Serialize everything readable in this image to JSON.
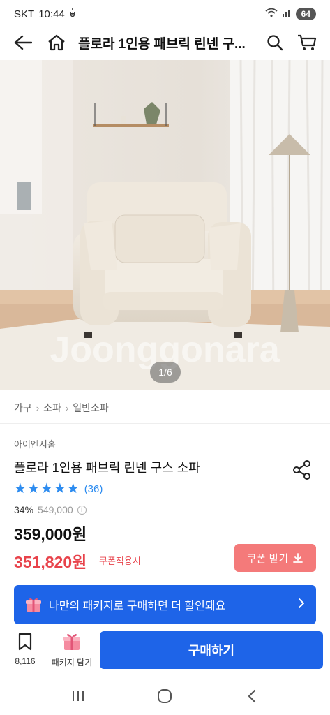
{
  "status": {
    "carrier": "SKT",
    "time": "10:44",
    "battery": "64"
  },
  "header": {
    "title": "플로라 1인용 패브릭 린넨 구..."
  },
  "hero": {
    "watermark": "Joonggonara",
    "page_indicator": "1/6"
  },
  "breadcrumb": [
    "가구",
    "소파",
    "일반소파"
  ],
  "product": {
    "brand": "아이엔지홈",
    "name": "플로라 1인용 패브릭 린넨 구스 소파",
    "rating_stars": 5,
    "review_count": "(36)",
    "discount_rate": "34%",
    "original_price": "549,000",
    "price": "359,000원",
    "coupon_price": "351,820원",
    "coupon_label": "쿠폰적용시",
    "coupon_button": "쿠폰 받기"
  },
  "package_banner": {
    "text": "나만의 패키지로 구매하면 더 할인돼요"
  },
  "bottom_bar": {
    "wish_count": "8,116",
    "package_label": "패키지 담기",
    "buy_label": "구매하기"
  },
  "colors": {
    "accent_blue": "#1e64e8",
    "sale_red": "#e8434b",
    "coupon_button_bg": "#f47a7a",
    "star_blue": "#2d8cf0"
  }
}
